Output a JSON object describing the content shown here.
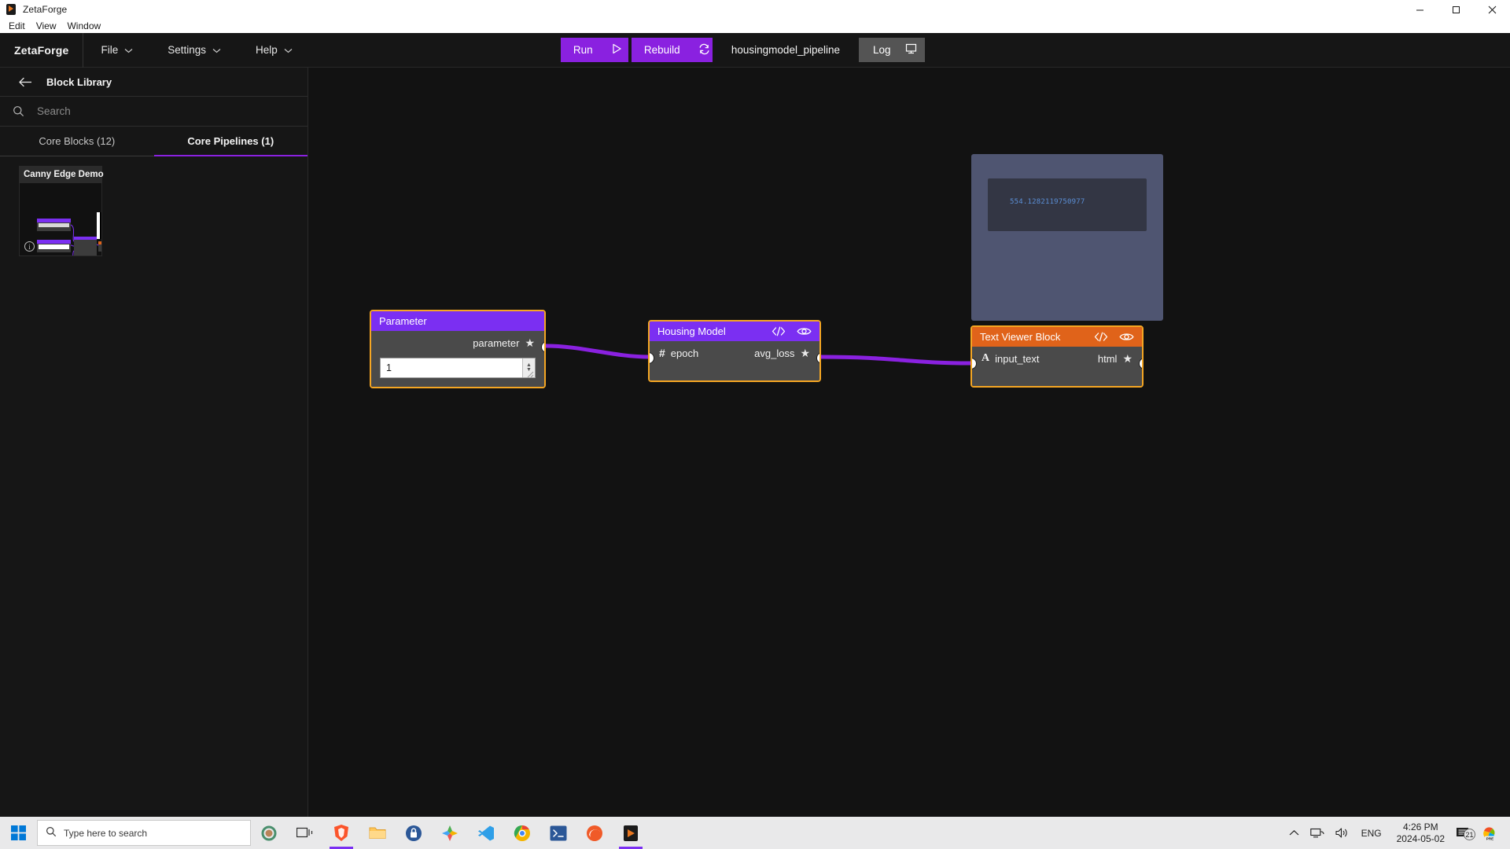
{
  "window": {
    "title": "ZetaForge",
    "app_icon": "zetaforge-icon",
    "controls": {
      "minimize": "minimize-icon",
      "maximize": "maximize-icon",
      "close": "close-icon"
    },
    "menu": [
      "Edit",
      "View",
      "Window"
    ]
  },
  "topbar": {
    "brand": "ZetaForge",
    "menus": [
      {
        "label": "File",
        "icon": "chevron-down-icon"
      },
      {
        "label": "Settings",
        "icon": "chevron-down-icon"
      },
      {
        "label": "Help",
        "icon": "chevron-down-icon"
      }
    ],
    "run_label": "Run",
    "run_icon": "play-icon",
    "rebuild_label": "Rebuild",
    "rebuild_icon": "refresh-icon",
    "pipeline_name": "housingmodel_pipeline",
    "log_label": "Log",
    "log_icon": "monitor-icon",
    "accent_purple": "#8a21e0",
    "log_bg": "#545454"
  },
  "sidebar": {
    "back_icon": "arrow-left-icon",
    "title": "Block Library",
    "search": {
      "placeholder": "Search",
      "value": "",
      "icon": "search-icon"
    },
    "tabs": [
      {
        "label": "Core Blocks (12)",
        "active": false
      },
      {
        "label": "Core Pipelines (1)",
        "active": true
      }
    ],
    "cards": [
      {
        "title": "Canny Edge Demo",
        "info_icon": "info-icon"
      }
    ]
  },
  "canvas": {
    "viewer": {
      "value": "554.1282119750977",
      "panel_color": "#4f5571",
      "inner_color": "#333644",
      "text_color": "#5b8fd6"
    },
    "nodes": [
      {
        "id": "parameter",
        "title": "Parameter",
        "header_color": "#7b2ff2",
        "border_color": "#f5a623",
        "output_label": "parameter",
        "output_star": "★",
        "input_value": "1"
      },
      {
        "id": "housing-model",
        "title": "Housing Model",
        "header_color": "#7b2ff2",
        "border_color": "#f5a623",
        "code_icon": "code-icon",
        "eye_icon": "eye-icon",
        "input_label": "epoch",
        "input_type_glyph": "#",
        "output_label": "avg_loss",
        "output_star": "★"
      },
      {
        "id": "text-viewer-block",
        "title": "Text Viewer Block",
        "header_color": "#e0631a",
        "border_color": "#f5a623",
        "code_icon": "code-icon",
        "eye_icon": "eye-icon",
        "input_label": "input_text",
        "input_type_glyph": "A",
        "output_label": "html",
        "output_star": "★"
      }
    ],
    "edge_color": "#8a21e0"
  },
  "taskbar": {
    "start_icon": "windows-start-icon",
    "search_placeholder": "Type here to search",
    "search_icon": "search-icon",
    "pinned": [
      "cortana-icon",
      "task-view-icon",
      "brave-icon",
      "file-explorer-icon",
      "security-icon",
      "store-icon",
      "vscode-icon",
      "chrome-icon",
      "terminal-icon",
      "edge-beta-icon",
      "zetaforge-icon"
    ],
    "tray": {
      "chevron_icon": "chevron-up-icon",
      "network_icon": "network-icon",
      "volume_icon": "volume-icon",
      "language": "ENG",
      "time": "4:26 PM",
      "date": "2024-05-02",
      "notification_icon": "notifications-icon",
      "notification_count": "21",
      "assistant_icon": "copilot-icon"
    }
  }
}
